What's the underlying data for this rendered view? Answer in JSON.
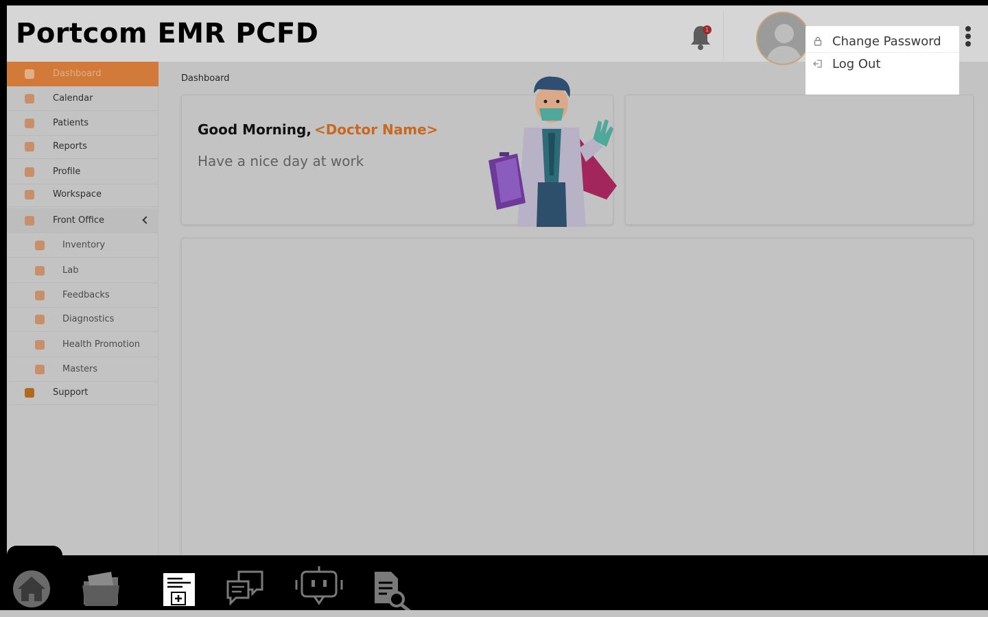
{
  "header": {
    "app_title": "Portcom EMR PCFD",
    "notification_count": "1"
  },
  "user_menu": {
    "items": [
      {
        "label": "Change Password",
        "icon": "lock-icon"
      },
      {
        "label": "Log Out",
        "icon": "logout-icon"
      }
    ]
  },
  "sidebar": {
    "items": [
      {
        "label": "Dashboard",
        "icon": "home-icon",
        "active": true
      },
      {
        "label": "Calendar",
        "icon": "calendar-icon"
      },
      {
        "label": "Patients",
        "icon": "patients-icon"
      },
      {
        "label": "Reports",
        "icon": "reports-icon"
      },
      {
        "label": "Profile",
        "icon": "profile-icon"
      },
      {
        "label": "Workspace",
        "icon": "workspace-icon"
      },
      {
        "label": "Front Office",
        "icon": "front-office-icon",
        "expanded": true
      },
      {
        "label": "Inventory",
        "icon": "inventory-icon"
      },
      {
        "label": "Lab",
        "icon": "lab-icon"
      },
      {
        "label": "Feedbacks",
        "icon": "feedbacks-icon"
      },
      {
        "label": "Diagnostics",
        "icon": "diagnostics-icon"
      },
      {
        "label": "Health Promotion",
        "icon": "health-promotion-icon"
      },
      {
        "label": "Masters",
        "icon": "masters-icon"
      },
      {
        "label": "Support",
        "icon": "support-icon"
      }
    ]
  },
  "main": {
    "breadcrumb": "Dashboard",
    "greeting": "Good Morning,",
    "doctor_name": "<Doctor Name>",
    "subgreeting": "Have a nice day at work"
  },
  "taskbar": {
    "items": [
      "home-icon",
      "folder-icon",
      "medical-record-icon",
      "chat-icon",
      "robot-icon",
      "document-search-icon"
    ]
  },
  "colors": {
    "accent": "#d17a3a",
    "overlay": "#c3c3c3"
  }
}
